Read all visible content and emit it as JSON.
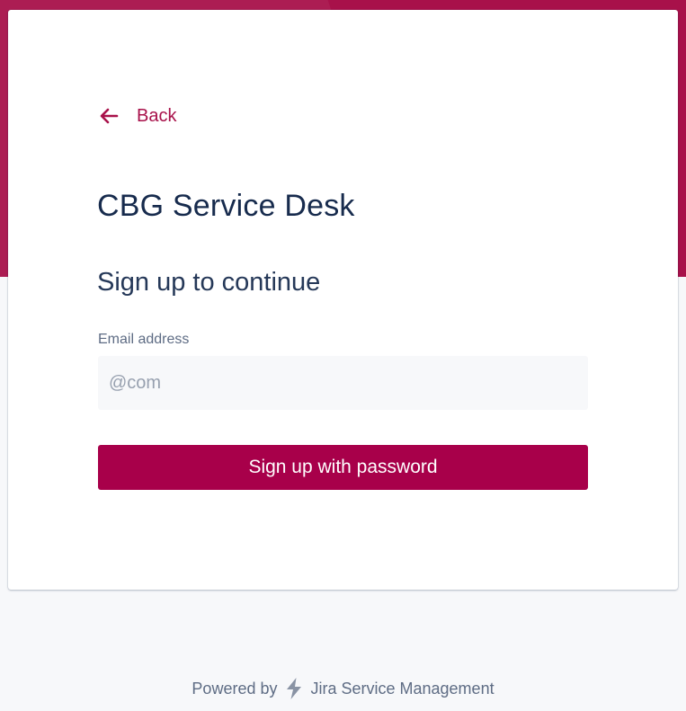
{
  "back": {
    "label": "Back"
  },
  "portal": {
    "title": "CBG Service Desk"
  },
  "form": {
    "heading": "Sign up to continue",
    "email_label": "Email address",
    "email_value": "@com",
    "submit_label": "Sign up with password"
  },
  "footer": {
    "powered_by": "Powered by",
    "product_name": "Jira Service Management",
    "logo_icon": "jira-service-management-logo-icon"
  },
  "colors": {
    "brand": "#a8114a",
    "button": "#a8004a",
    "title_text": "#172b4d",
    "page_background": "#f7f8fa"
  }
}
